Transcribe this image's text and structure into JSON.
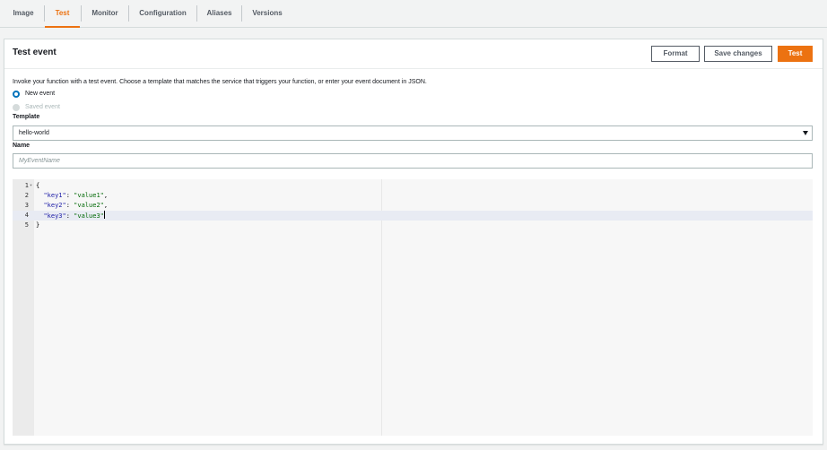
{
  "tabs": [
    {
      "label": "Image",
      "active": false
    },
    {
      "label": "Test",
      "active": true
    },
    {
      "label": "Monitor",
      "active": false
    },
    {
      "label": "Configuration",
      "active": false
    },
    {
      "label": "Aliases",
      "active": false
    },
    {
      "label": "Versions",
      "active": false
    }
  ],
  "panel": {
    "title": "Test event",
    "buttons": {
      "format": "Format",
      "save_changes": "Save changes",
      "test": "Test"
    },
    "intro": "Invoke your function with a test event. Choose a template that matches the service that triggers your function, or enter your event document in JSON.",
    "radios": {
      "new_event": "New event",
      "saved_event": "Saved event"
    },
    "template_label": "Template",
    "template_value": "hello-world",
    "name_label": "Name",
    "name_placeholder": "MyEventName"
  },
  "editor": {
    "lines": [
      {
        "num": "1",
        "fold": "▾",
        "tokens": [
          {
            "t": "p",
            "v": "{"
          }
        ]
      },
      {
        "num": "2",
        "fold": "",
        "tokens": [
          {
            "t": "p",
            "v": "  "
          },
          {
            "t": "k",
            "v": "\"key1\""
          },
          {
            "t": "p",
            "v": ": "
          },
          {
            "t": "s",
            "v": "\"value1\""
          },
          {
            "t": "p",
            "v": ","
          }
        ]
      },
      {
        "num": "3",
        "fold": "",
        "tokens": [
          {
            "t": "p",
            "v": "  "
          },
          {
            "t": "k",
            "v": "\"key2\""
          },
          {
            "t": "p",
            "v": ": "
          },
          {
            "t": "s",
            "v": "\"value2\""
          },
          {
            "t": "p",
            "v": ","
          }
        ]
      },
      {
        "num": "4",
        "fold": "",
        "tokens": [
          {
            "t": "p",
            "v": "  "
          },
          {
            "t": "k",
            "v": "\"key3\""
          },
          {
            "t": "p",
            "v": ": "
          },
          {
            "t": "s",
            "v": "\"value3\""
          }
        ]
      },
      {
        "num": "5",
        "fold": "",
        "tokens": [
          {
            "t": "p",
            "v": "}"
          }
        ]
      }
    ],
    "active_line": 4
  },
  "colors": {
    "accent": "#ec7211",
    "radio_selected": "#0073bb",
    "json_key": "#1a1aa6",
    "json_string": "#036a07"
  }
}
